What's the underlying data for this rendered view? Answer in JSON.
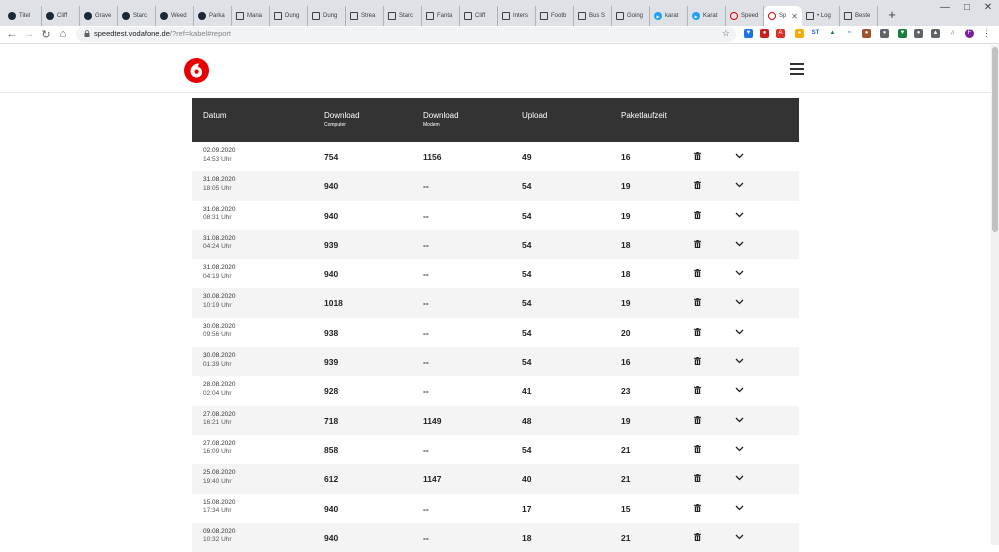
{
  "browser": {
    "tabs": [
      {
        "label": "Titel",
        "icon": "steam-icon"
      },
      {
        "label": "Cliff",
        "icon": "steam-icon"
      },
      {
        "label": "Grave",
        "icon": "steam-icon"
      },
      {
        "label": "Starc",
        "icon": "steam-icon"
      },
      {
        "label": "Weed",
        "icon": "steam-icon"
      },
      {
        "label": "Parka",
        "icon": "steam-icon"
      },
      {
        "label": "Mana",
        "icon": "web-icon"
      },
      {
        "label": "Dung",
        "icon": "web-icon"
      },
      {
        "label": "Dung",
        "icon": "web-icon"
      },
      {
        "label": "Strea",
        "icon": "web-icon"
      },
      {
        "label": "Starc",
        "icon": "web-icon"
      },
      {
        "label": "Fanta",
        "icon": "web-icon"
      },
      {
        "label": "Cliff",
        "icon": "web-icon"
      },
      {
        "label": "Inters",
        "icon": "web-icon"
      },
      {
        "label": "Footb",
        "icon": "web-icon"
      },
      {
        "label": "Bus S",
        "icon": "web-icon"
      },
      {
        "label": "Going",
        "icon": "web-icon"
      },
      {
        "label": "karat",
        "icon": "play-icon"
      },
      {
        "label": "Karat",
        "icon": "play-icon"
      },
      {
        "label": "Speed",
        "icon": "opera-icon"
      },
      {
        "label": "Sp",
        "icon": "opera-icon",
        "active": true
      },
      {
        "label": "• Log",
        "icon": "web-icon"
      },
      {
        "label": "Beste",
        "icon": "web-icon"
      }
    ],
    "url_host": "speedtest.vodafone.de",
    "url_path": "/?ref=kabel#report"
  },
  "report": {
    "headers": {
      "date": "Datum",
      "download_computer": "Download",
      "download_computer_sub": "Computer",
      "download_modem": "Download",
      "download_modem_sub": "Modem",
      "upload": "Upload",
      "latency": "Paketlaufzeit"
    },
    "rows": [
      {
        "date": "02.09.2020",
        "time": "14:53 Uhr",
        "dl_computer": "754",
        "dl_modem": "1156",
        "upload": "49",
        "latency": "16"
      },
      {
        "date": "31.08.2020",
        "time": "18:05 Uhr",
        "dl_computer": "940",
        "dl_modem": "--",
        "upload": "54",
        "latency": "19"
      },
      {
        "date": "31.08.2020",
        "time": "08:31 Uhr",
        "dl_computer": "940",
        "dl_modem": "--",
        "upload": "54",
        "latency": "19"
      },
      {
        "date": "31.08.2020",
        "time": "04:24 Uhr",
        "dl_computer": "939",
        "dl_modem": "--",
        "upload": "54",
        "latency": "18"
      },
      {
        "date": "31.08.2020",
        "time": "04:19 Uhr",
        "dl_computer": "940",
        "dl_modem": "--",
        "upload": "54",
        "latency": "18"
      },
      {
        "date": "30.08.2020",
        "time": "10:19 Uhr",
        "dl_computer": "1018",
        "dl_modem": "--",
        "upload": "54",
        "latency": "19"
      },
      {
        "date": "30.08.2020",
        "time": "09:56 Uhr",
        "dl_computer": "938",
        "dl_modem": "--",
        "upload": "54",
        "latency": "20"
      },
      {
        "date": "30.08.2020",
        "time": "01:39 Uhr",
        "dl_computer": "939",
        "dl_modem": "--",
        "upload": "54",
        "latency": "16"
      },
      {
        "date": "28.08.2020",
        "time": "02:04 Uhr",
        "dl_computer": "928",
        "dl_modem": "--",
        "upload": "41",
        "latency": "23"
      },
      {
        "date": "27.08.2020",
        "time": "16:21 Uhr",
        "dl_computer": "718",
        "dl_modem": "1149",
        "upload": "48",
        "latency": "19"
      },
      {
        "date": "27.08.2020",
        "time": "16:09 Uhr",
        "dl_computer": "858",
        "dl_modem": "--",
        "upload": "54",
        "latency": "21"
      },
      {
        "date": "25.08.2020",
        "time": "19:40 Uhr",
        "dl_computer": "612",
        "dl_modem": "1147",
        "upload": "40",
        "latency": "21"
      },
      {
        "date": "15.08.2020",
        "time": "17:34 Uhr",
        "dl_computer": "940",
        "dl_modem": "--",
        "upload": "17",
        "latency": "15"
      },
      {
        "date": "09.08.2020",
        "time": "10:32 Uhr",
        "dl_computer": "940",
        "dl_modem": "--",
        "upload": "18",
        "latency": "21"
      }
    ]
  },
  "colors": {
    "brand_red": "#e60000",
    "table_header": "#333333"
  }
}
